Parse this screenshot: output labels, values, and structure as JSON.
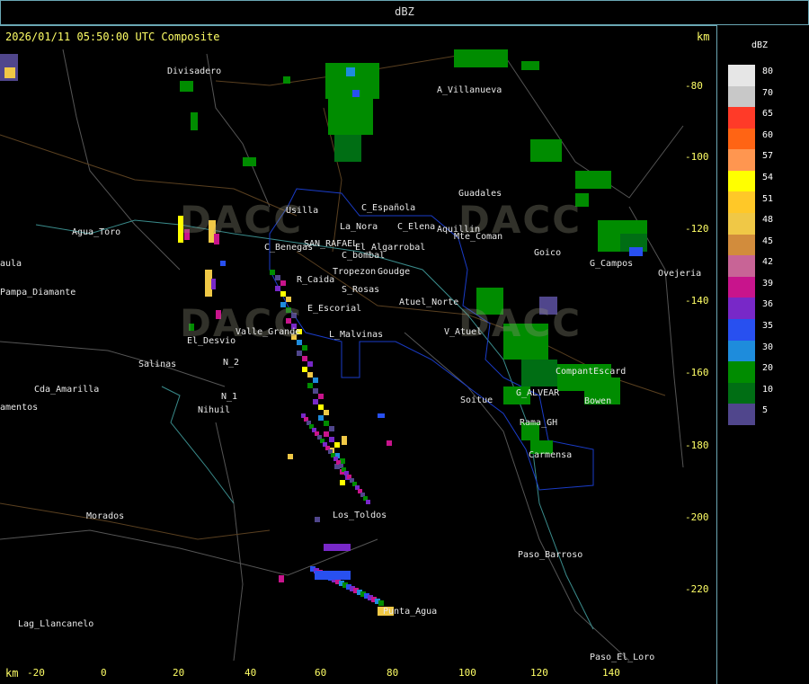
{
  "header": {
    "title": "dBZ"
  },
  "map": {
    "timestamp": "2026/01/11 05:50:00 UTC Composite",
    "km_label": "km",
    "x_ticks": [
      "-20",
      "0",
      "20",
      "40",
      "60",
      "80",
      "100",
      "120",
      "140"
    ],
    "y_ticks": [
      "-80",
      "-100",
      "-120",
      "-140",
      "-160",
      "-180",
      "-200",
      "-220"
    ],
    "watermark": "DACC",
    "places": [
      {
        "name": "Divisadero"
      },
      {
        "name": "A_Villanueva"
      },
      {
        "name": "Guadales"
      },
      {
        "name": "Usilla"
      },
      {
        "name": "C_Española"
      },
      {
        "name": "La_Nora"
      },
      {
        "name": "C_Elena"
      },
      {
        "name": "Aquillin"
      },
      {
        "name": "Mte_Coman"
      },
      {
        "name": "Goico"
      },
      {
        "name": "G_Campos"
      },
      {
        "name": "Agua_Toro"
      },
      {
        "name": "Pampa_Diamante"
      },
      {
        "name": "C_Benegas"
      },
      {
        "name": "SAN_RAFAEL"
      },
      {
        "name": "El_Algarrobal"
      },
      {
        "name": "C_bombal"
      },
      {
        "name": "Tropezon"
      },
      {
        "name": "Goudge"
      },
      {
        "name": "R_Caida"
      },
      {
        "name": "S_Rosas"
      },
      {
        "name": "Atuel_Norte"
      },
      {
        "name": "E_Escorial"
      },
      {
        "name": "El_Desvio"
      },
      {
        "name": "Valle_Grande"
      },
      {
        "name": "L_Malvinas"
      },
      {
        "name": "V_Atuel"
      },
      {
        "name": "Salinas"
      },
      {
        "name": "Cda_Amarilla"
      },
      {
        "name": "Nihuil"
      },
      {
        "name": "N_1"
      },
      {
        "name": "N_2"
      },
      {
        "name": "Soitue"
      },
      {
        "name": "G_ALVEAR"
      },
      {
        "name": "Bowen"
      },
      {
        "name": "CompantEscard"
      },
      {
        "name": "Carmensa"
      },
      {
        "name": "Los_Toldos"
      },
      {
        "name": "Morados"
      },
      {
        "name": "Paso_Barroso"
      },
      {
        "name": "Punta_Agua"
      },
      {
        "name": "Lag_Llancanelo"
      },
      {
        "name": "Paso_El_Loro"
      },
      {
        "name": "Rama_GH"
      },
      {
        "name": "Ovejeria"
      },
      {
        "name": "amentos"
      },
      {
        "name": "aula"
      }
    ]
  },
  "colorbar": {
    "title": "dBZ",
    "levels": [
      {
        "label": "80",
        "color": "#e6e6e6"
      },
      {
        "label": "70",
        "color": "#c8c8c8"
      },
      {
        "label": "65",
        "color": "#ff3a28"
      },
      {
        "label": "60",
        "color": "#ff6414"
      },
      {
        "label": "57",
        "color": "#ff9650"
      },
      {
        "label": "54",
        "color": "#ffff00"
      },
      {
        "label": "51",
        "color": "#ffc828"
      },
      {
        "label": "48",
        "color": "#f0c846"
      },
      {
        "label": "45",
        "color": "#d28c3c"
      },
      {
        "label": "42",
        "color": "#c86496"
      },
      {
        "label": "39",
        "color": "#c8148c"
      },
      {
        "label": "36",
        "color": "#7828c8"
      },
      {
        "label": "35",
        "color": "#2850f0"
      },
      {
        "label": "30",
        "color": "#1e8cdc"
      },
      {
        "label": "20",
        "color": "#008c00"
      },
      {
        "label": "10",
        "color": "#006e14"
      },
      {
        "label": "5",
        "color": "#50468c"
      }
    ]
  }
}
